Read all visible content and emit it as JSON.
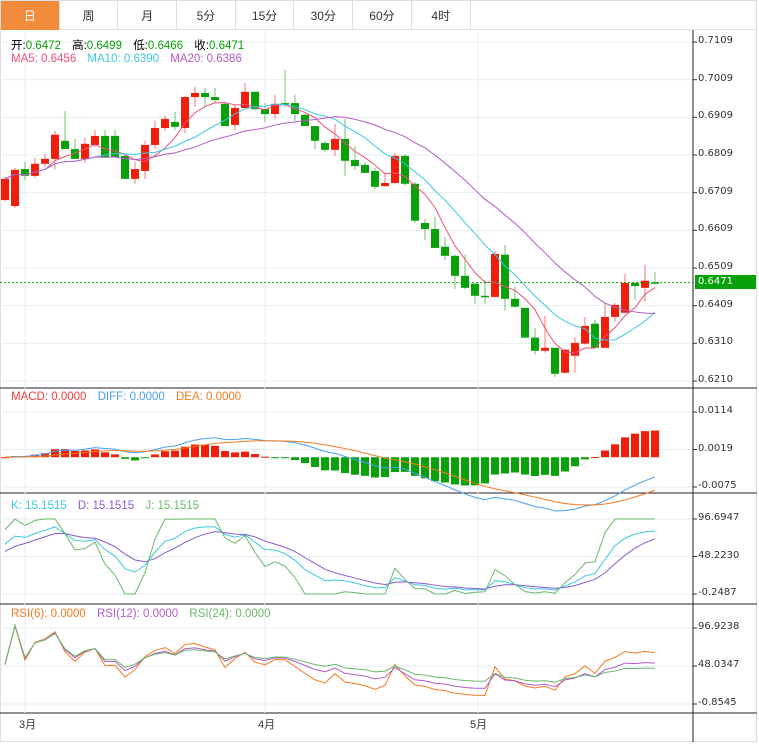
{
  "tabs": [
    "日",
    "周",
    "月",
    "5分",
    "15分",
    "30分",
    "60分",
    "4时"
  ],
  "active_tab": 0,
  "ohlc_legend": {
    "open_label": "开:",
    "open": "0.6472",
    "high_label": "高:",
    "high": "0.6499",
    "low_label": "低:",
    "low": "0.6466",
    "close_label": "收:",
    "close": "0.6471"
  },
  "ma_legend": {
    "ma5": "MA5: 0.6456",
    "ma10": "MA10: 0.6390",
    "ma20": "MA20: 0.6386"
  },
  "macd_legend": {
    "macd": "MACD: 0.0000",
    "diff": "DIFF: 0.0000",
    "dea": "DEA: 0.0000"
  },
  "kdj_legend": {
    "k": "K: 15.1515",
    "d": "D: 15.1515",
    "j": "J: 15.1515"
  },
  "rsi_legend": {
    "rsi6": "RSI(6): 0.0000",
    "rsi12": "RSI(12): 0.0000",
    "rsi24": "RSI(24): 0.0000"
  },
  "last_price": "0.6471",
  "x_labels": [
    "3月",
    "4月",
    "5月"
  ],
  "colors": {
    "up": "#f01e0a",
    "down": "#09a109",
    "ma5": "#f0507a",
    "ma10": "#3cc8e0",
    "ma20": "#b45ac8",
    "diff": "#4aa0f0",
    "dea": "#f57a1e",
    "k": "#3cc8e0",
    "d": "#8a5ad2",
    "j": "#6ab86a",
    "rsi6": "#f57a1e",
    "rsi12": "#b45ac8",
    "rsi24": "#6ab86a",
    "tab_active": "#f28c3c"
  },
  "chart_data": {
    "type": "candlestick",
    "price_axis": {
      "ticks": [
        "0.7109",
        "0.7009",
        "0.6909",
        "0.6809",
        "0.6709",
        "0.6609",
        "0.6509",
        "0.6409",
        "0.6310",
        "0.6210"
      ],
      "ylim": [
        0.621,
        0.7109
      ]
    },
    "macd_axis": {
      "ticks": [
        "0.0114",
        "0.0019",
        "-0.0075"
      ],
      "ylim": [
        -0.0075,
        0.0114
      ]
    },
    "kdj_axis": {
      "ticks": [
        "96.6947",
        "48.2230",
        "-0.2487"
      ],
      "ylim": [
        -0.2487,
        96.6947
      ]
    },
    "rsi_axis": {
      "ticks": [
        "96.9238",
        "48.0347",
        "-0.8545"
      ],
      "ylim": [
        -0.8545,
        96.9238
      ]
    },
    "ohlc": [
      [
        0.669,
        0.6751,
        0.6685,
        0.6746
      ],
      [
        0.6674,
        0.6775,
        0.6669,
        0.677
      ],
      [
        0.6772,
        0.6791,
        0.6743,
        0.6754
      ],
      [
        0.6754,
        0.6802,
        0.6749,
        0.6786
      ],
      [
        0.6786,
        0.6812,
        0.6778,
        0.6799
      ],
      [
        0.6799,
        0.6873,
        0.6772,
        0.6863
      ],
      [
        0.6847,
        0.6926,
        0.6825,
        0.6825
      ],
      [
        0.6825,
        0.6852,
        0.6799,
        0.6799
      ],
      [
        0.6799,
        0.6855,
        0.6788,
        0.6839
      ],
      [
        0.6836,
        0.6876,
        0.6831,
        0.686
      ],
      [
        0.686,
        0.6876,
        0.6802,
        0.6802
      ],
      [
        0.686,
        0.6876,
        0.6804,
        0.6804
      ],
      [
        0.6807,
        0.6807,
        0.6746,
        0.6746
      ],
      [
        0.6746,
        0.6791,
        0.6733,
        0.6772
      ],
      [
        0.6767,
        0.6847,
        0.6746,
        0.6836
      ],
      [
        0.6836,
        0.69,
        0.6825,
        0.6881
      ],
      [
        0.6881,
        0.6913,
        0.6873,
        0.6905
      ],
      [
        0.6897,
        0.6924,
        0.6876,
        0.6884
      ],
      [
        0.6881,
        0.6966,
        0.6868,
        0.6963
      ],
      [
        0.6963,
        0.699,
        0.6937,
        0.6974
      ],
      [
        0.6974,
        0.6987,
        0.6937,
        0.6963
      ],
      [
        0.6963,
        0.6987,
        0.6947,
        0.6955
      ],
      [
        0.6945,
        0.695,
        0.6886,
        0.6886
      ],
      [
        0.6889,
        0.6942,
        0.6876,
        0.6934
      ],
      [
        0.6934,
        0.7,
        0.6934,
        0.6977
      ],
      [
        0.6977,
        0.6977,
        0.6931,
        0.6931
      ],
      [
        0.6931,
        0.6947,
        0.6897,
        0.6918
      ],
      [
        0.6918,
        0.6969,
        0.6905,
        0.6945
      ],
      [
        0.6947,
        0.7035,
        0.6937,
        0.6944
      ],
      [
        0.6947,
        0.6969,
        0.69,
        0.6918
      ],
      [
        0.6916,
        0.6918,
        0.6886,
        0.6886
      ],
      [
        0.6886,
        0.6886,
        0.6825,
        0.6847
      ],
      [
        0.6841,
        0.6847,
        0.6818,
        0.6823
      ],
      [
        0.6823,
        0.6892,
        0.6807,
        0.6852
      ],
      [
        0.6852,
        0.6905,
        0.6754,
        0.6794
      ],
      [
        0.6796,
        0.6833,
        0.677,
        0.678
      ],
      [
        0.6783,
        0.6791,
        0.6762,
        0.6762
      ],
      [
        0.6767,
        0.6775,
        0.6719,
        0.6725
      ],
      [
        0.6727,
        0.6762,
        0.6725,
        0.6735
      ],
      [
        0.6735,
        0.6815,
        0.6733,
        0.6807
      ],
      [
        0.6807,
        0.6812,
        0.6727,
        0.6733
      ],
      [
        0.6733,
        0.6738,
        0.6629,
        0.6635
      ],
      [
        0.6629,
        0.664,
        0.6584,
        0.6613
      ],
      [
        0.6613,
        0.6645,
        0.6563,
        0.6563
      ],
      [
        0.6566,
        0.6592,
        0.6531,
        0.6542
      ],
      [
        0.6542,
        0.6545,
        0.6454,
        0.6489
      ],
      [
        0.6489,
        0.6545,
        0.6454,
        0.6457
      ],
      [
        0.6468,
        0.6468,
        0.6415,
        0.6436
      ],
      [
        0.6436,
        0.6478,
        0.6415,
        0.6433
      ],
      [
        0.6433,
        0.6555,
        0.6433,
        0.6547
      ],
      [
        0.6545,
        0.6571,
        0.6396,
        0.6428
      ],
      [
        0.6428,
        0.646,
        0.6404,
        0.6407
      ],
      [
        0.6404,
        0.6404,
        0.6325,
        0.6325
      ],
      [
        0.6325,
        0.6351,
        0.628,
        0.629
      ],
      [
        0.629,
        0.6383,
        0.6285,
        0.6298
      ],
      [
        0.6298,
        0.6298,
        0.6221,
        0.6229
      ],
      [
        0.6232,
        0.6295,
        0.6229,
        0.6293
      ],
      [
        0.6277,
        0.6325,
        0.6232,
        0.6311
      ],
      [
        0.6309,
        0.638,
        0.6306,
        0.6356
      ],
      [
        0.6362,
        0.6372,
        0.6295,
        0.6298
      ],
      [
        0.6298,
        0.6417,
        0.6298,
        0.638
      ],
      [
        0.638,
        0.6417,
        0.6367,
        0.6412
      ],
      [
        0.6391,
        0.6494,
        0.6391,
        0.647
      ],
      [
        0.647,
        0.647,
        0.6425,
        0.6462
      ],
      [
        0.6457,
        0.6518,
        0.642,
        0.6476
      ],
      [
        0.6472,
        0.6499,
        0.6466,
        0.6471
      ]
    ]
  }
}
